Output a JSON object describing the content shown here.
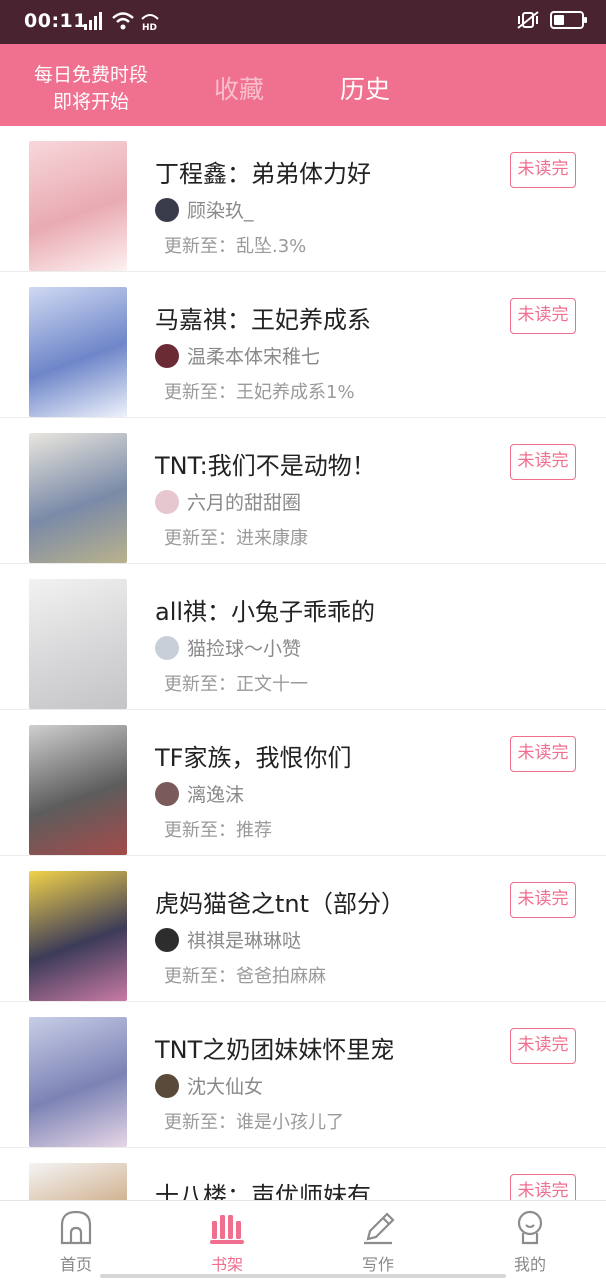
{
  "status_bar": {
    "time": "00:11",
    "network": "4G",
    "hd": "HD",
    "battery_percent": 35
  },
  "header": {
    "promo_line1": "每日免费时段",
    "promo_line2": "即将开始",
    "tab_favorites": "收藏",
    "tab_history": "历史"
  },
  "books": [
    {
      "title": "丁程鑫：弟弟体力好",
      "author": "顾染玖_",
      "update": "更新至：乱坠.3%",
      "badge": "未读完",
      "cover_colors": [
        "#f7d7da",
        "#e9aab2",
        "#fdf1f1"
      ],
      "avatar_color": "#3a3b4a"
    },
    {
      "title": "马嘉祺：王妃养成系",
      "author": "温柔本体宋稚七",
      "update": "更新至：王妃养成系1%",
      "badge": "未读完",
      "cover_colors": [
        "#cfd9f2",
        "#6e86c9",
        "#eef2fb"
      ],
      "avatar_color": "#6a2b34"
    },
    {
      "title": "TNT:我们不是动物！",
      "author": "六月的甜甜圈",
      "update": "更新至：进来康康",
      "badge": "未读完",
      "cover_colors": [
        "#e9e6dd",
        "#7a8aa8",
        "#b9b28c"
      ],
      "avatar_color": "#e6c7cf"
    },
    {
      "title": "all祺：小兔子乖乖的",
      "author": "猫捡球～小赞",
      "update": "更新至：正文十一",
      "badge": "",
      "cover_colors": [
        "#f2f2f2",
        "#d7d7d9",
        "#c4c4c7"
      ],
      "avatar_color": "#c9cfd8"
    },
    {
      "title": "TF家族，我恨你们",
      "author": "漓逸沫",
      "update": "更新至：推荐",
      "badge": "未读完",
      "cover_colors": [
        "#cfcfcf",
        "#5d5d5d",
        "#a44a4a"
      ],
      "avatar_color": "#7a5a5a"
    },
    {
      "title": "虎妈猫爸之tnt（部分）",
      "author": "祺祺是琳琳哒",
      "update": "更新至：爸爸拍麻麻",
      "badge": "未读完",
      "cover_colors": [
        "#f1d24a",
        "#3c3b58",
        "#c97aa4"
      ],
      "avatar_color": "#2d2d2d"
    },
    {
      "title": "TNT之奶团妹妹怀里宠",
      "author": "沈大仙女",
      "update": "更新至：谁是小孩儿了",
      "badge": "未读完",
      "cover_colors": [
        "#c8cde6",
        "#7b83b5",
        "#e6d6e6"
      ],
      "avatar_color": "#5a4a3a"
    },
    {
      "title": "十八楼：声优师妹有...",
      "author": "",
      "update": "",
      "badge": "未读完",
      "cover_colors": [
        "#f4f4f4",
        "#c9a37a",
        "#8a6a4a"
      ],
      "avatar_color": "#cccccc"
    }
  ],
  "bottom_nav": [
    {
      "label": "首页",
      "icon": "home-icon",
      "active": false
    },
    {
      "label": "书架",
      "icon": "bookshelf-icon",
      "active": true
    },
    {
      "label": "写作",
      "icon": "pencil-icon",
      "active": false
    },
    {
      "label": "我的",
      "icon": "profile-icon",
      "active": false
    }
  ],
  "colors": {
    "accent": "#f06e8e",
    "header_bg": "#f0708f",
    "status_bg": "#4a2330"
  }
}
